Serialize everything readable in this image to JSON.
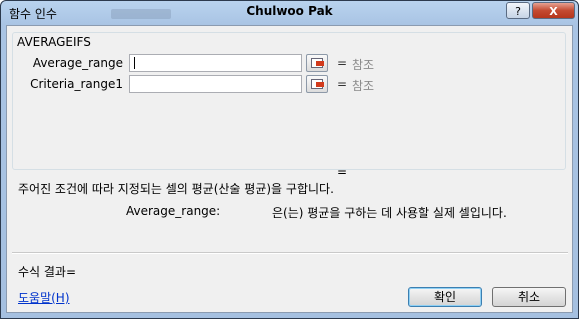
{
  "window": {
    "title_left": "함수 인수",
    "title_center": "Chulwoo Pak",
    "help_label": "?",
    "close_label": "X"
  },
  "function": {
    "name": "AVERAGEIFS",
    "args": [
      {
        "label": "Average_range",
        "value": "",
        "eq": "=",
        "result": "참조"
      },
      {
        "label": "Criteria_range1",
        "value": "",
        "eq": "=",
        "result": "참조"
      }
    ],
    "result_eq": "=",
    "description": "주어진 조건에 따라 지정되는 셀의 평균(산술 평균)을 구합니다.",
    "arg_desc_name": "Average_range:",
    "arg_desc_text": "은(는) 평균을 구하는 데 사용할 실제 셀입니다."
  },
  "footer": {
    "formula_result": "수식 결과=",
    "help_link": "도움말(H)",
    "ok_label": "확인",
    "cancel_label": "취소"
  }
}
